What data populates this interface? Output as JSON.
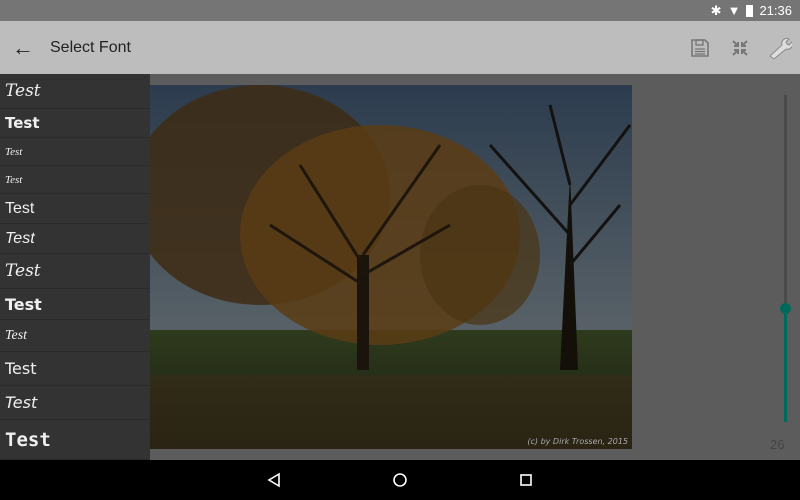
{
  "status_bar": {
    "time": "21:36",
    "icons": [
      "bluetooth-icon",
      "wifi-icon",
      "battery-icon"
    ]
  },
  "app_bar": {
    "title": "Select Font",
    "actions": [
      "save-icon",
      "fullscreen-exit-icon",
      "wrench-icon"
    ]
  },
  "font_list": {
    "items": [
      "Test",
      "Test",
      "Test",
      "Test",
      "Test",
      "Test",
      "Test",
      "Test",
      "Test",
      "Test",
      "Test",
      "Test"
    ]
  },
  "photo": {
    "credit": "(c) by Dirk Trossen, 2015"
  },
  "size_slider": {
    "value": "26",
    "fraction": 0.35,
    "accent": "#00695c"
  },
  "nav_bar": {
    "buttons": [
      "back",
      "home",
      "recents"
    ]
  }
}
